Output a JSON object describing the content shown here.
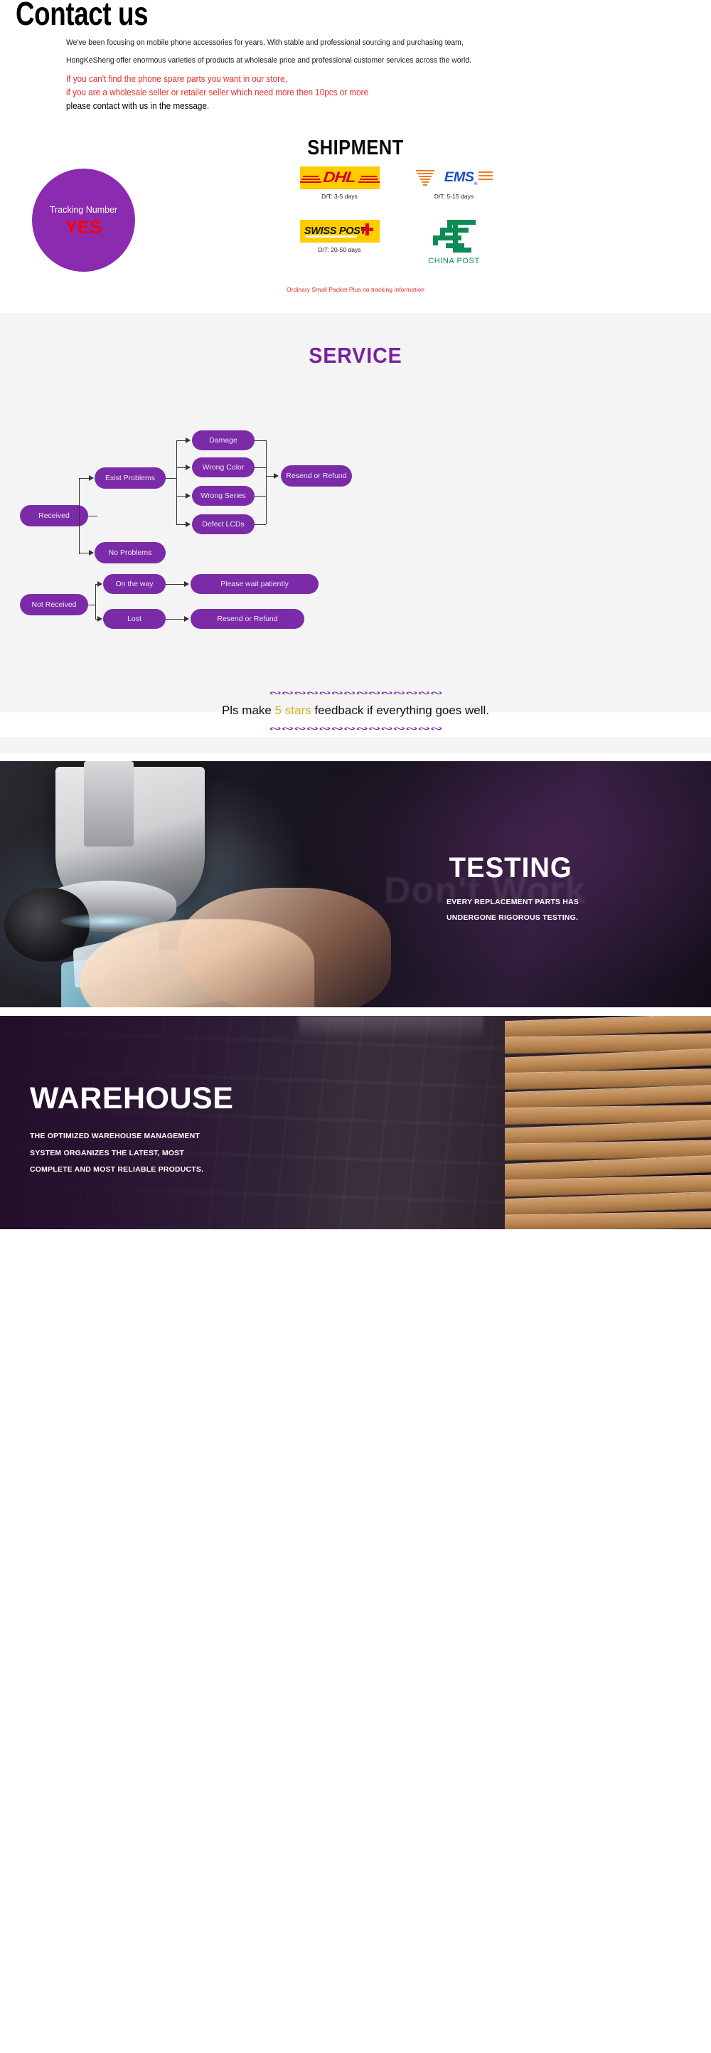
{
  "contact": {
    "title": "Contact us",
    "paragraph1": "We've been focusing on mobile phone accessories for years. With stable and professional sourcing and purchasing team,",
    "paragraph2": "HongKeSheng offer enormous varieties of products at wholesale price and professional customer services across the world.",
    "red_line1": "If you can't find the phone spare parts you want in our store,",
    "red_line2": "if you are a wholesale seller or retailer seller which need more then 10pcs or more",
    "black_line": "please contact with us in the message."
  },
  "shipment": {
    "title": "SHIPMENT",
    "tracking_label": "Tracking Number",
    "tracking_value": "YES",
    "circle_color": "#8b2bb0",
    "note": "Ordinary Small Packet Plus no tracking information",
    "note_color": "#e8292b",
    "carriers": [
      {
        "name": "DHL",
        "logo": "dhl-logo",
        "dt": "D/T: 3-5 days"
      },
      {
        "name": "EMS",
        "logo": "ems-logo",
        "dt": "D/T: 5-15 days"
      },
      {
        "name": "SWISS POST",
        "logo": "swiss-post-logo",
        "dt": "D/T: 20-50 days"
      },
      {
        "name": "CHINA POST",
        "logo": "china-post-logo",
        "dt": ""
      }
    ]
  },
  "service": {
    "title": "SERVICE",
    "accent_color": "#7B1FA2",
    "node_color": "#7B2BA8",
    "nodes": {
      "received": "Received",
      "exist_problems": "Exist Problems",
      "no_problems": "No Problems",
      "damage": "Damage",
      "wrong_color": "Wrong Color",
      "wrong_series": "Wrong Series",
      "defect_lcds": "Defect LCDs",
      "resend_or_refund": "Resend or Refund",
      "not_received": "Not Received",
      "on_the_way": "On the way",
      "lost": "Lost",
      "please_wait": "Please wait patiently",
      "resend_or_refund2": "Resend or Refund"
    }
  },
  "feedback": {
    "prefix": "Pls make ",
    "highlight": "5 stars",
    "suffix": " feedback if everything goes well.",
    "highlight_color": "#D8B520",
    "ornament": "❦❦❦❦❦❦"
  },
  "testing": {
    "heading": "TESTING",
    "sub_line1": "EVERY REPLACEMENT PARTS HAS",
    "sub_line2": "UNDERGONE RIGOROUS TESTING.",
    "ghost_text": "Don't Work"
  },
  "warehouse": {
    "heading": "WAREHOUSE",
    "sub_line1": "THE OPTIMIZED WAREHOUSE MANAGEMENT",
    "sub_line2": "SYSTEM ORGANIZES THE LATEST, MOST",
    "sub_line3": "COMPLETE AND MOST RELIABLE PRODUCTS."
  }
}
